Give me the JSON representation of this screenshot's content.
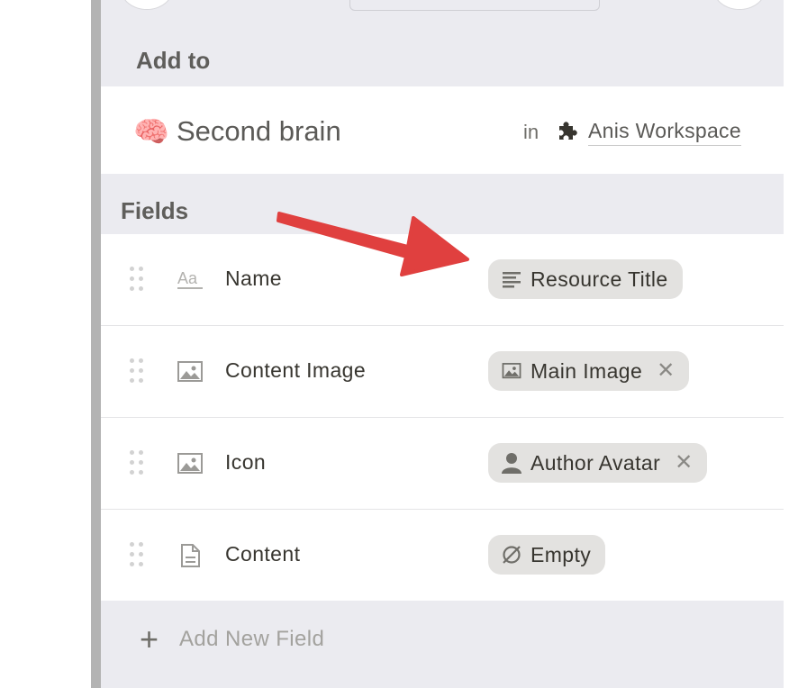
{
  "add_to": {
    "section_label": "Add to",
    "database": {
      "emoji": "🧠",
      "title": "Second brain"
    },
    "in_label": "in",
    "workspace": {
      "icon": "puzzle-icon",
      "name": "Anis Workspace"
    }
  },
  "fields": {
    "section_label": "Fields",
    "items": [
      {
        "type_icon": "text-aa-icon",
        "name": "Name",
        "mapping": {
          "icon": "text-lines-icon",
          "label": "Resource Title",
          "removable": false
        }
      },
      {
        "type_icon": "image-icon",
        "name": "Content Image",
        "mapping": {
          "icon": "image-icon",
          "label": "Main Image",
          "removable": true,
          "remove_glyph": "✕"
        }
      },
      {
        "type_icon": "image-icon",
        "name": "Icon",
        "mapping": {
          "icon": "person-icon",
          "label": "Author Avatar",
          "removable": true,
          "remove_glyph": "✕"
        }
      },
      {
        "type_icon": "document-icon",
        "name": "Content",
        "mapping": {
          "icon": "empty-set-icon",
          "label": "Empty",
          "removable": false
        }
      }
    ],
    "add_label": "Add New Field",
    "add_glyph": "+"
  },
  "annotation": {
    "type": "arrow",
    "color": "#e0403f"
  },
  "colors": {
    "panel_bg": "#ebebf0",
    "chip_bg": "#e3e2e0",
    "arrow": "#e0403f"
  }
}
